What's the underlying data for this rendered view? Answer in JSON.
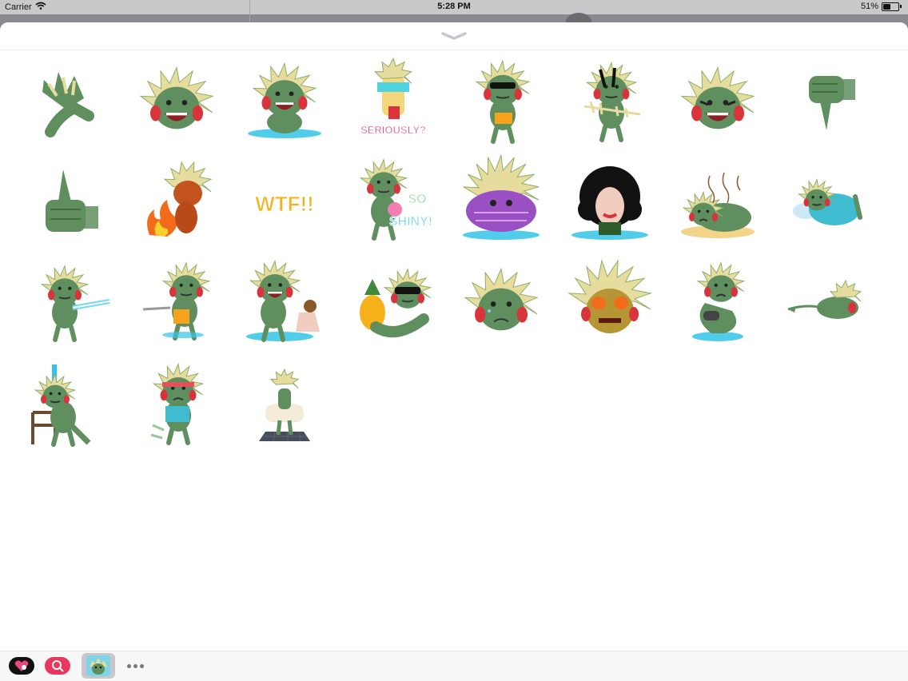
{
  "status_bar": {
    "carrier": "Carrier",
    "time": "5:28 PM",
    "battery": "51%",
    "battery_level": 0.51
  },
  "stickers": [
    {
      "id": "hand-wave",
      "caption": ""
    },
    {
      "id": "big-grin",
      "caption": ""
    },
    {
      "id": "splash-grin",
      "caption": ""
    },
    {
      "id": "seriously",
      "caption": "SERIOUSLY?"
    },
    {
      "id": "cool-shades",
      "caption": ""
    },
    {
      "id": "fishbone",
      "caption": ""
    },
    {
      "id": "laugh-tear",
      "caption": ""
    },
    {
      "id": "thumbs-down",
      "caption": ""
    },
    {
      "id": "thumbs-up",
      "caption": ""
    },
    {
      "id": "fire",
      "caption": ""
    },
    {
      "id": "wtf",
      "caption": "WTF!!"
    },
    {
      "id": "so-shiny",
      "caption": "SO SHINY!"
    },
    {
      "id": "purple-crab",
      "caption": ""
    },
    {
      "id": "curly-hair",
      "caption": ""
    },
    {
      "id": "stinky",
      "caption": ""
    },
    {
      "id": "sleeping",
      "caption": ""
    },
    {
      "id": "laser",
      "caption": ""
    },
    {
      "id": "water-gun",
      "caption": ""
    },
    {
      "id": "with-girl",
      "caption": ""
    },
    {
      "id": "pineapple",
      "caption": ""
    },
    {
      "id": "sad-face",
      "caption": ""
    },
    {
      "id": "fire-eyes",
      "caption": ""
    },
    {
      "id": "gaming",
      "caption": ""
    },
    {
      "id": "swimming",
      "caption": ""
    },
    {
      "id": "shower-chair",
      "caption": ""
    },
    {
      "id": "running",
      "caption": ""
    },
    {
      "id": "marilyn",
      "caption": ""
    }
  ],
  "drawer": {
    "apps": [
      {
        "name": "heart-app",
        "selected": false
      },
      {
        "name": "search-app",
        "selected": false
      },
      {
        "name": "monster-stickers",
        "selected": true
      },
      {
        "name": "more",
        "selected": false
      }
    ]
  },
  "colors": {
    "monster_green": "#5f8f5e",
    "crest_yellow": "#e6dc9e",
    "cheek_red": "#d9343b",
    "water_blue": "#33c4e8"
  }
}
